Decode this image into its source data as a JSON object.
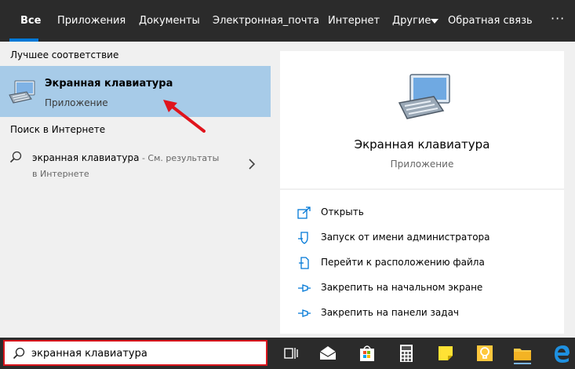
{
  "tabs": [
    {
      "label": "Все",
      "active": true
    },
    {
      "label": "Приложения"
    },
    {
      "label": "Документы"
    },
    {
      "label": "Электронная_почта"
    },
    {
      "label": "Интернет"
    },
    {
      "label": "Другие"
    },
    {
      "label": "Обратная связь"
    }
  ],
  "more_label": "···",
  "left": {
    "best_match_title": "Лучшее соответствие",
    "best_match": {
      "title": "Экранная клавиатура",
      "subtitle": "Приложение",
      "icon": "keyboard-monitor-icon"
    },
    "web_title": "Поиск в Интернете",
    "web_result": {
      "query": "экранная клавиатура",
      "suffix": " - См. результаты",
      "line2": "в Интернете"
    }
  },
  "preview": {
    "title": "Экранная клавиатура",
    "subtitle": "Приложение",
    "actions": [
      {
        "label": "Открыть",
        "icon": "open-icon"
      },
      {
        "label": "Запуск от имени администратора",
        "icon": "shield-icon"
      },
      {
        "label": "Перейти к расположению файла",
        "icon": "file-location-icon"
      },
      {
        "label": "Закрепить на начальном экране",
        "icon": "pin-icon"
      },
      {
        "label": "Закрепить на панели задач",
        "icon": "pin-icon"
      }
    ]
  },
  "search": {
    "value": "экранная клавиатура"
  },
  "taskbar_icons": [
    "task-view-icon",
    "mail-icon",
    "store-icon",
    "calculator-icon",
    "sticky-notes-icon",
    "tips-icon",
    "file-explorer-icon",
    "edge-icon"
  ],
  "colors": {
    "accent": "#0078d7",
    "selected": "#a7cbe8",
    "dark": "#2b2b2b",
    "highlight_border": "#d8141c"
  }
}
